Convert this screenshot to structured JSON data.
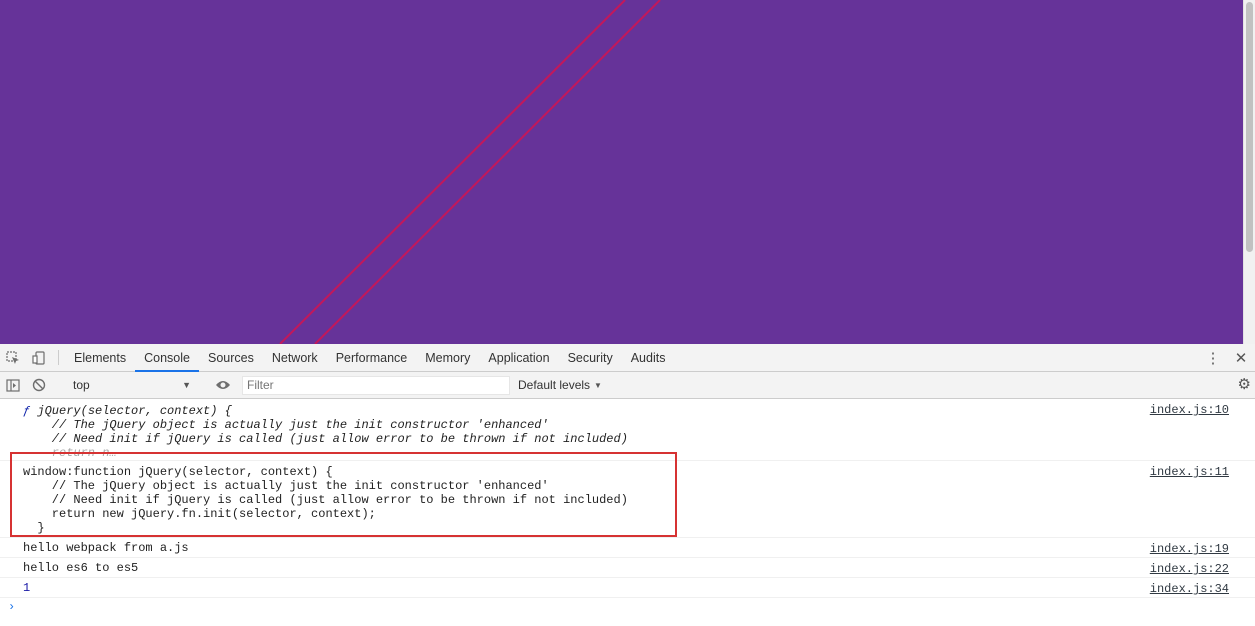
{
  "tabs": [
    {
      "label": "Elements"
    },
    {
      "label": "Console"
    },
    {
      "label": "Sources"
    },
    {
      "label": "Network"
    },
    {
      "label": "Performance"
    },
    {
      "label": "Memory"
    },
    {
      "label": "Application"
    },
    {
      "label": "Security"
    },
    {
      "label": "Audits"
    }
  ],
  "active_tab": "Console",
  "toolbar": {
    "context": "top",
    "filter_placeholder": "Filter",
    "levels_label": "Default levels"
  },
  "messages": [
    {
      "source": "index.js:10",
      "f_glyph": "ƒ",
      "signature": " jQuery(selector, context) {",
      "body": "    // The jQuery object is actually just the init constructor 'enhanced'\n    // Need init if jQuery is called (just allow error to be thrown if not included)",
      "truncated": "    return n…"
    },
    {
      "source": "index.js:11",
      "text": "window:function jQuery(selector, context) {\n    // The jQuery object is actually just the init constructor 'enhanced'\n    // Need init if jQuery is called (just allow error to be thrown if not included)\n    return new jQuery.fn.init(selector, context);\n  }"
    },
    {
      "source": "index.js:19",
      "text": "hello webpack from a.js"
    },
    {
      "source": "index.js:22",
      "text": "hello es6 to es5"
    },
    {
      "source": "index.js:34",
      "text": "1"
    }
  ],
  "prompt": "›",
  "colors": {
    "page_background": "#663399",
    "diagonal_lines": "#c2185b",
    "highlight_box": "#d63232",
    "active_tab_underline": "#1a73e8"
  },
  "icons": {
    "inspect": "inspect-element-icon",
    "device": "device-toolbar-icon",
    "more": "more-vert-icon",
    "close": "close-icon",
    "sidebar": "console-sidebar-icon",
    "clear": "clear-console-icon",
    "eye": "live-expression-icon",
    "settings": "gear-icon"
  }
}
